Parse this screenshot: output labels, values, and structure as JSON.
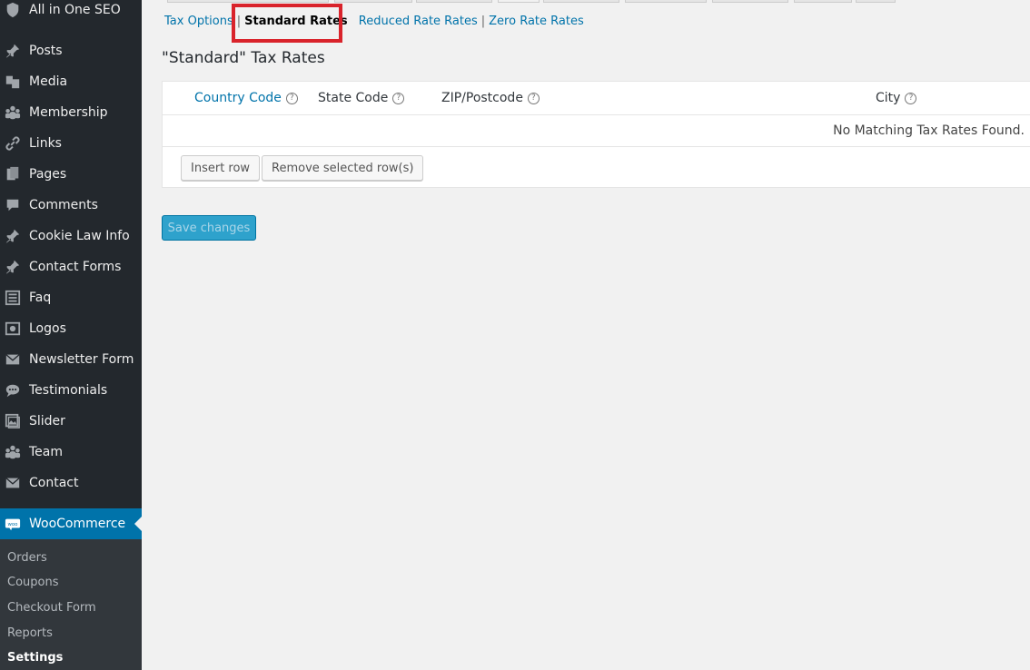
{
  "sidebar": {
    "items": [
      {
        "label": "All in One SEO",
        "icon": "shield-icon"
      },
      {
        "label": "Posts",
        "icon": "pin-icon"
      },
      {
        "label": "Media",
        "icon": "media-icon"
      },
      {
        "label": "Membership",
        "icon": "groups-icon"
      },
      {
        "label": "Links",
        "icon": "link-icon"
      },
      {
        "label": "Pages",
        "icon": "pages-icon"
      },
      {
        "label": "Comments",
        "icon": "comment-icon"
      },
      {
        "label": "Cookie Law Info",
        "icon": "pin-icon"
      },
      {
        "label": "Contact Forms",
        "icon": "pin-icon"
      },
      {
        "label": "Faq",
        "icon": "list-icon"
      },
      {
        "label": "Logos",
        "icon": "camera-icon"
      },
      {
        "label": "Newsletter Form",
        "icon": "mail-icon"
      },
      {
        "label": "Testimonials",
        "icon": "chat-icon"
      },
      {
        "label": "Slider",
        "icon": "gallery-icon"
      },
      {
        "label": "Team",
        "icon": "groups-icon"
      },
      {
        "label": "Contact",
        "icon": "mail-icon"
      },
      {
        "label": "WooCommerce",
        "icon": "woo-icon"
      }
    ],
    "submenu": [
      {
        "label": "Orders"
      },
      {
        "label": "Coupons"
      },
      {
        "label": "Checkout Form"
      },
      {
        "label": "Reports"
      },
      {
        "label": "Settings"
      }
    ]
  },
  "sections": {
    "tax_options": "Tax Options",
    "standard_rates": "Standard Rates",
    "reduced_rates": "Reduced Rate Rates",
    "zero_rates": "Zero Rate Rates",
    "separator": "|"
  },
  "page_title": "\"Standard\" Tax Rates",
  "table": {
    "columns": [
      "Country Code",
      "State Code",
      "ZIP/Postcode",
      "City"
    ],
    "help_glyph": "?",
    "empty_message": "No Matching Tax Rates Found."
  },
  "buttons": {
    "insert_row": "Insert row",
    "remove_rows": "Remove selected row(s)",
    "save": "Save changes"
  },
  "colors": {
    "sidebar_bg": "#23282d",
    "active_menu": "#0073aa",
    "link": "#0073aa",
    "highlight": "#d9232b",
    "save_button": "#2ea2cc"
  }
}
